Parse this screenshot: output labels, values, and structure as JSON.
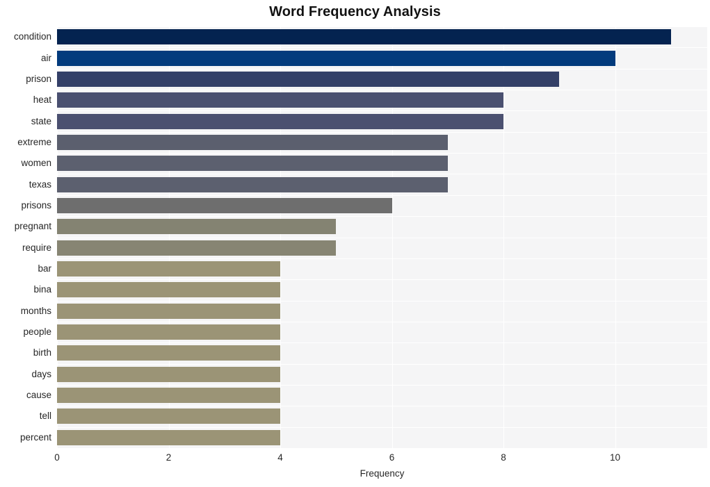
{
  "chart_data": {
    "type": "bar",
    "orientation": "horizontal",
    "title": "Word Frequency Analysis",
    "xlabel": "Frequency",
    "ylabel": "",
    "categories": [
      "condition",
      "air",
      "prison",
      "heat",
      "state",
      "extreme",
      "women",
      "texas",
      "prisons",
      "pregnant",
      "require",
      "bar",
      "bina",
      "months",
      "people",
      "birth",
      "days",
      "cause",
      "tell",
      "percent"
    ],
    "values": [
      11,
      10,
      9,
      8,
      8,
      7,
      7,
      7,
      6,
      5,
      5,
      4,
      4,
      4,
      4,
      4,
      4,
      4,
      4,
      4
    ],
    "bar_colors": [
      "#042350",
      "#033b7d",
      "#344068",
      "#4a5070",
      "#4b5070",
      "#5b5f6e",
      "#5c606f",
      "#5c606f",
      "#6e6e6e",
      "#848372",
      "#878573",
      "#9b9476",
      "#9b9476",
      "#9b9476",
      "#9b9476",
      "#9b9476",
      "#9b9476",
      "#9b9476",
      "#9b9476",
      "#9b9476"
    ],
    "xlim": [
      0,
      11.65
    ],
    "x_ticks": [
      0,
      2,
      4,
      6,
      8,
      10
    ],
    "x_tick_labels": [
      "0",
      "2",
      "4",
      "6",
      "8",
      "10"
    ],
    "grid": true,
    "grid_color": "#ffffff",
    "plot_background": "#f5f5f6",
    "figure_background": "#ffffff",
    "legend": null,
    "legend_position": "none"
  }
}
